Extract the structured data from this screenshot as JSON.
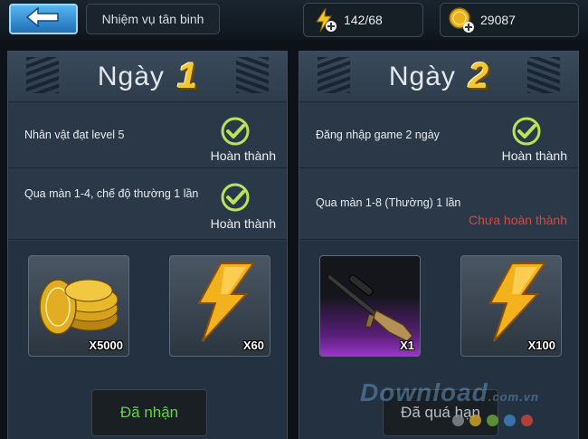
{
  "header": {
    "back_icon": "arrow-left-icon",
    "title": "Nhiệm vụ tân binh",
    "energy": {
      "icon": "lightning-plus-icon",
      "value": "142/68"
    },
    "gold": {
      "icon": "gold-coin-plus-icon",
      "value": "29087"
    }
  },
  "days": [
    {
      "label": "Ngày",
      "number": "1",
      "tasks": [
        {
          "text": "Nhân vật đạt level 5",
          "status": "Hoàn thành",
          "done": true
        },
        {
          "text": "Qua màn 1-4, chế độ thường 1 lần",
          "status": "Hoàn thành",
          "done": true
        }
      ],
      "rewards": [
        {
          "icon": "gold-coins-icon",
          "qty": "X5000"
        },
        {
          "icon": "lightning-energy-icon",
          "qty": "X60"
        }
      ],
      "button": "Đã nhận"
    },
    {
      "label": "Ngày",
      "number": "2",
      "tasks": [
        {
          "text": "Đăng nhập game 2 ngày",
          "status": "Hoàn thành",
          "done": true
        },
        {
          "text": "Qua màn 1-8 (Thường) 1 lần",
          "status": "Chưa hoàn thành",
          "done": false
        }
      ],
      "rewards": [
        {
          "icon": "sniper-rifle-icon",
          "qty": "X1"
        },
        {
          "icon": "lightning-energy-icon",
          "qty": "X100"
        }
      ],
      "button": "Đã quá hạn"
    }
  ],
  "watermark": {
    "text": "Download",
    "suffix": ".com.vn"
  },
  "colors": {
    "accent_gold": "#f5c832",
    "done_green": "#5fd64a",
    "fail_red": "#e0453e",
    "panel_bg": "#2b3948"
  }
}
